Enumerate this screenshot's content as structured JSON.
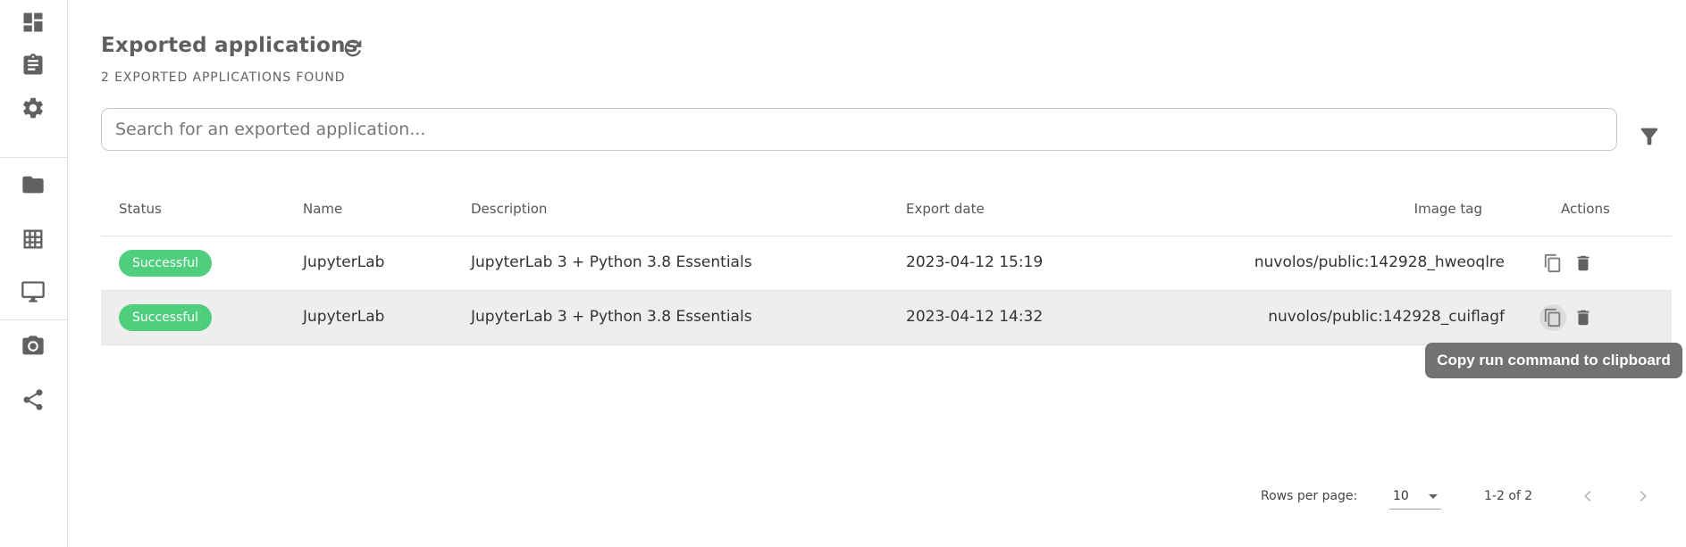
{
  "sidebar": {
    "items": [
      {
        "icon": "dashboard-icon"
      },
      {
        "icon": "clipboard-icon"
      },
      {
        "icon": "gear-icon"
      },
      {
        "icon": "folder-icon"
      },
      {
        "icon": "table-icon"
      },
      {
        "icon": "monitor-icon"
      },
      {
        "icon": "camera-icon"
      },
      {
        "icon": "share-icon"
      }
    ]
  },
  "header": {
    "title": "Exported applications",
    "refresh_icon": "refresh-icon",
    "subtitle": "2 EXPORTED APPLICATIONS FOUND"
  },
  "search": {
    "placeholder": "Search for an exported application...",
    "value": "",
    "filter_icon": "filter-icon"
  },
  "table": {
    "columns": [
      "Status",
      "Name",
      "Description",
      "Export date",
      "Image tag",
      "Actions"
    ],
    "rows": [
      {
        "status": "Successful",
        "name": "JupyterLab",
        "description": "JupyterLab 3 + Python 3.8 Essentials",
        "export_date": "2023-04-12 15:19",
        "image_tag": "nuvolos/public:142928_hweoqlre"
      },
      {
        "status": "Successful",
        "name": "JupyterLab",
        "description": "JupyterLab 3 + Python 3.8 Essentials",
        "export_date": "2023-04-12 14:32",
        "image_tag": "nuvolos/public:142928_cuiflagf"
      }
    ],
    "status_color": "#4fcf7d",
    "hovered_row_index": 1
  },
  "pagination": {
    "rows_per_page_label": "Rows per page:",
    "rows_per_page": "10",
    "range": "1-2 of 2"
  },
  "tooltip": {
    "text": "Copy run command to clipboard"
  }
}
